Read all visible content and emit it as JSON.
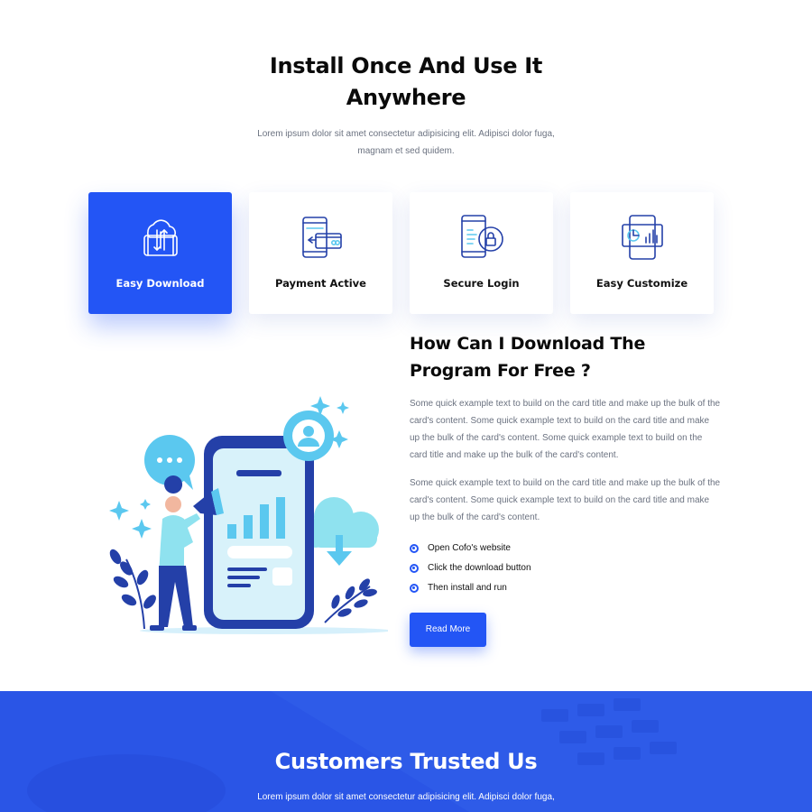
{
  "intro": {
    "title": "Install Once And Use It Anywhere",
    "description": "Lorem ipsum dolor sit amet consectetur adipisicing elit. Adipisci dolor fuga, magnam et sed quidem."
  },
  "features": [
    {
      "label": "Easy Download",
      "icon": "cloud-download-phone-icon",
      "active": true
    },
    {
      "label": "Payment Active",
      "icon": "phone-payment-card-icon",
      "active": false
    },
    {
      "label": "Secure Login",
      "icon": "phone-lock-icon",
      "active": false
    },
    {
      "label": "Easy Customize",
      "icon": "dashboard-monitor-icon",
      "active": false
    }
  ],
  "faq": {
    "title": "How Can I Download The Program For Free ?",
    "paragraph1": "Some quick example text to build on the card title and make up the bulk of the card's content. Some quick example text to build on the card title and make up the bulk of the card's content. Some quick example text to build on the card title and make up the bulk of the card's content.",
    "paragraph2": "Some quick example text to build on the card title and make up the bulk of the card's content. Some quick example text to build on the card title and make up the bulk of the card's content.",
    "steps": [
      "Open Cofo's website",
      "Click the download button",
      "Then install and run"
    ],
    "button_label": "Read More"
  },
  "trusted": {
    "title": "Customers Trusted Us",
    "description": "Lorem ipsum dolor sit amet consectetur adipisicing elit. Adipisci dolor fuga,"
  },
  "colors": {
    "accent": "#2355f5",
    "banner": "#2a55e6",
    "text_muted": "#6b7280",
    "illustration_light": "#5bc8ef",
    "illustration_dark": "#2440a8"
  }
}
